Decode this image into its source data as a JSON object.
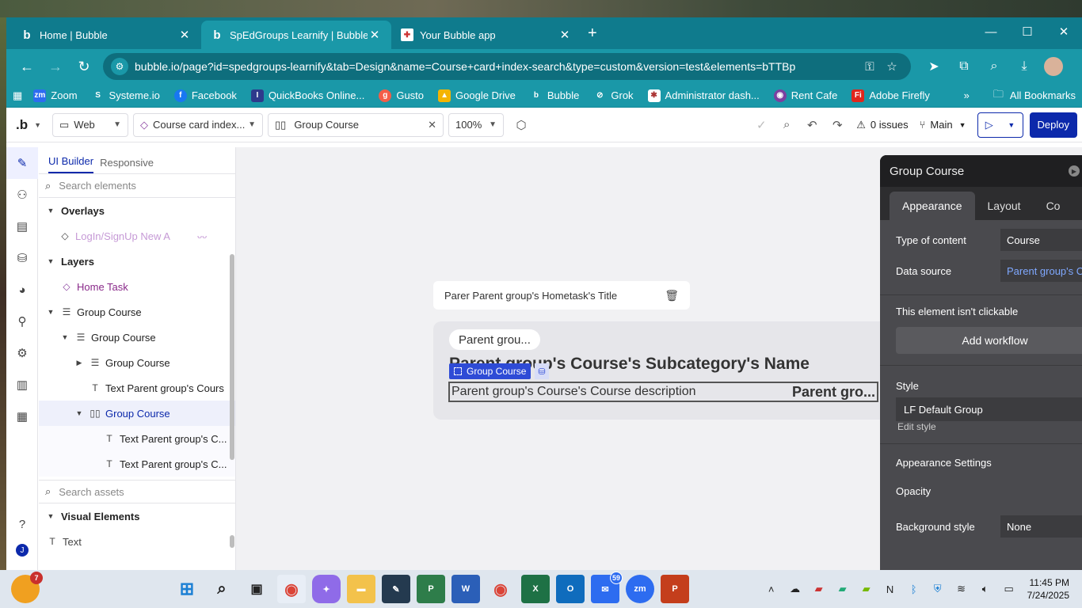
{
  "browser": {
    "tabs": [
      {
        "label": "Home | Bubble",
        "active": false
      },
      {
        "label": "SpEdGroups Learnify | Bubble E",
        "active": true
      },
      {
        "label": "Your Bubble app",
        "active": false
      }
    ],
    "url": "bubble.io/page?id=spedgroups-learnify&tab=Design&name=Course+card+index-search&type=custom&version=test&elements=bTTBp",
    "bookmarks": [
      "Zoom",
      "Systeme.io",
      "Facebook",
      "QuickBooks Online...",
      "Gusto",
      "Google Drive",
      "Bubble",
      "Grok",
      "Administrator dash...",
      "Rent Cafe",
      "Adobe Firefly"
    ],
    "all_bookmarks": "All Bookmarks"
  },
  "editor": {
    "logo": ".b",
    "platform": "Web",
    "page_name": "Course card index...",
    "element_selector": "Group Course",
    "zoom": "100%",
    "issues": "0 issues",
    "branch": "Main",
    "deploy": "Deploy"
  },
  "left_panel": {
    "tabs": [
      "UI Builder",
      "Responsive"
    ],
    "search_placeholder": "Search elements",
    "overlays_label": "Overlays",
    "overlay_item": "LogIn/SignUp New A",
    "layers_label": "Layers",
    "layers": [
      {
        "label": "Home Task",
        "depth": 0
      },
      {
        "label": "Group Course",
        "depth": 0
      },
      {
        "label": "Group Course",
        "depth": 1
      },
      {
        "label": "Group Course",
        "depth": 2
      },
      {
        "label": "Text Parent group's Cours",
        "depth": 2
      },
      {
        "label": "Group Course",
        "depth": 2
      },
      {
        "label": "Text Parent group's C...",
        "depth": 3
      },
      {
        "label": "Text Parent group's C...",
        "depth": 3
      }
    ],
    "assets_placeholder": "Search assets",
    "visual_elements_label": "Visual Elements",
    "text_item": "Text"
  },
  "canvas": {
    "title_pill": "Parer Parent group's Hometask's Title",
    "chip": "Parent grou...",
    "subcategory": "Parent group's Course's Subcategory's Name",
    "group_tag": "Group Course",
    "description": "Parent group's Course's Course description",
    "right_text": "Parent gro..."
  },
  "property_editor": {
    "title": "Group Course",
    "tabs": [
      "Appearance",
      "Layout",
      "Co"
    ],
    "type_of_content_label": "Type of content",
    "type_of_content_value": "Course",
    "data_source_label": "Data source",
    "data_source_value": "Parent group's Co",
    "not_clickable": "This element isn't clickable",
    "add_workflow": "Add workflow",
    "style_label": "Style",
    "style_value": "LF Default Group",
    "edit_style": "Edit style",
    "appearance_settings": "Appearance Settings",
    "opacity_label": "Opacity",
    "background_label": "Background style",
    "background_value": "None"
  },
  "taskbar": {
    "weather_badge": "7",
    "mail_badge": "59",
    "time": "11:45 PM",
    "date": "7/24/2025"
  }
}
